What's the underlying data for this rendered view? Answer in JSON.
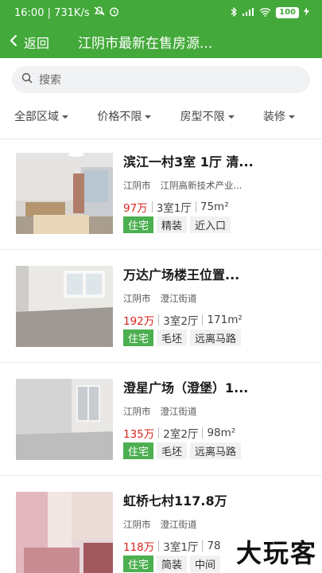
{
  "status_bar": {
    "time_speed": "16:00 | 731K/s",
    "battery": "100"
  },
  "nav": {
    "back_label": "返回",
    "title": "江阴市最新在售房源..."
  },
  "search": {
    "placeholder": "搜索"
  },
  "filters": [
    {
      "label": "全部区域"
    },
    {
      "label": "价格不限"
    },
    {
      "label": "房型不限"
    },
    {
      "label": "装修"
    }
  ],
  "listings": [
    {
      "name": "滨江一村3室 1厅 清...",
      "city": "江阴市",
      "district": "江阴高新技术产业...",
      "price": "97万",
      "layout": "3室1厅",
      "area": "75m²",
      "tags": [
        "住宅",
        "精装",
        "近入口"
      ]
    },
    {
      "name": "万达广场楼王位置...",
      "city": "江阴市",
      "district": "澄江街道",
      "price": "192万",
      "layout": "3室2厅",
      "area": "171m²",
      "tags": [
        "住宅",
        "毛坯",
        "远离马路"
      ]
    },
    {
      "name": "澄星广场（澄堡）1...",
      "city": "江阴市",
      "district": "澄江街道",
      "price": "135万",
      "layout": "2室2厅",
      "area": "98m²",
      "tags": [
        "住宅",
        "毛坯",
        "远离马路"
      ]
    },
    {
      "name": "虹桥七村117.8万",
      "city": "江阴市",
      "district": "澄江街道",
      "price": "118万",
      "layout": "3室1厅",
      "area": "78",
      "tags": [
        "住宅",
        "简装",
        "中间"
      ]
    }
  ],
  "watermark": "大玩客"
}
